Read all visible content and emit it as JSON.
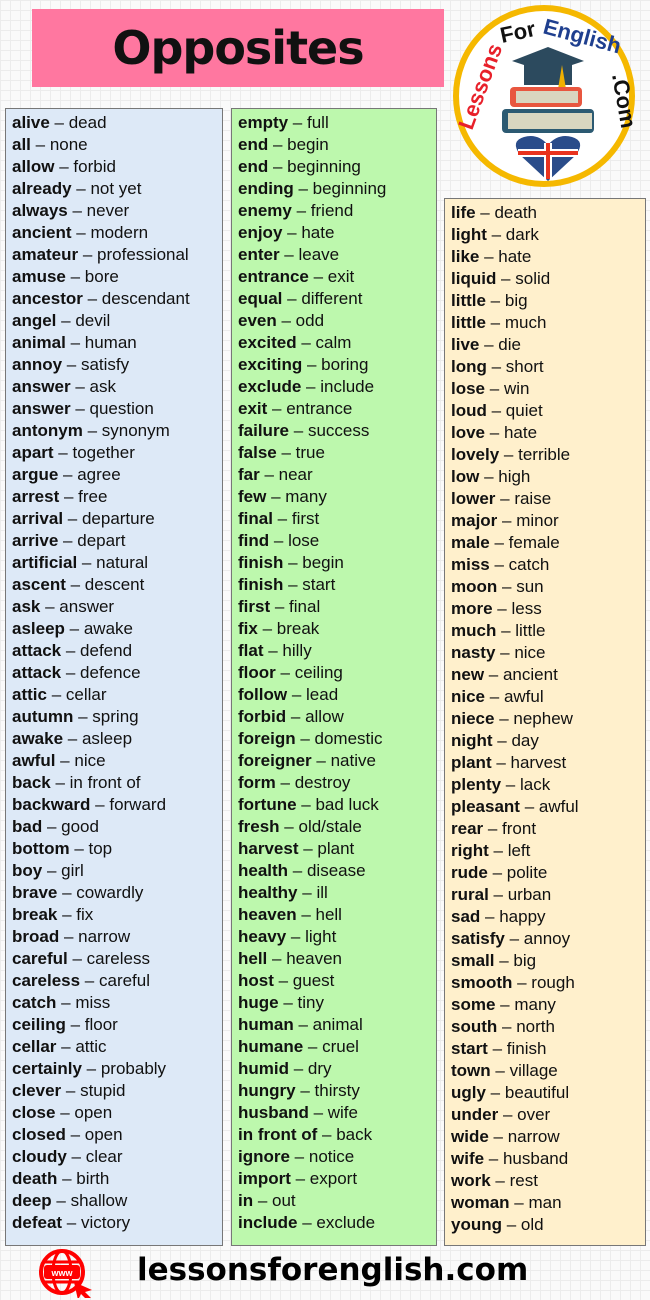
{
  "title": "Opposites",
  "logo_text": "LessonsForEnglish.Com",
  "footer": {
    "url": "lessonsforenglish.com",
    "icon": "www-globe-cursor-icon"
  },
  "colors": {
    "title_bg": "#ff77a0",
    "col1_bg": "#dde9f7",
    "col2_bg": "#bdf8ad",
    "col3_bg": "#fff0cc",
    "logo_ring": "#f5b800"
  },
  "columns": [
    [
      [
        "alive",
        "dead"
      ],
      [
        "all",
        "none"
      ],
      [
        "allow",
        "forbid"
      ],
      [
        "already",
        "not yet"
      ],
      [
        "always",
        "never"
      ],
      [
        "ancient",
        "modern"
      ],
      [
        "amateur",
        "professional"
      ],
      [
        "amuse",
        "bore"
      ],
      [
        "ancestor",
        "descendant"
      ],
      [
        "angel",
        "devil"
      ],
      [
        "animal",
        "human"
      ],
      [
        "annoy",
        "satisfy"
      ],
      [
        "answer",
        "ask"
      ],
      [
        "answer",
        "question"
      ],
      [
        "antonym",
        "synonym"
      ],
      [
        "apart",
        "together"
      ],
      [
        "argue",
        "agree"
      ],
      [
        "arrest",
        "free"
      ],
      [
        "arrival",
        "departure"
      ],
      [
        "arrive",
        "depart"
      ],
      [
        "artificial",
        "natural"
      ],
      [
        "ascent",
        "descent"
      ],
      [
        "ask",
        "answer"
      ],
      [
        "asleep",
        "awake"
      ],
      [
        "attack",
        "defend"
      ],
      [
        "attack",
        "defence"
      ],
      [
        "attic",
        "cellar"
      ],
      [
        "autumn",
        "spring"
      ],
      [
        "awake",
        "asleep"
      ],
      [
        "awful",
        "nice"
      ],
      [
        "back",
        "in front of"
      ],
      [
        "backward",
        "forward"
      ],
      [
        "bad",
        "good"
      ],
      [
        "bottom",
        "top"
      ],
      [
        "boy",
        "girl"
      ],
      [
        "brave",
        "cowardly"
      ],
      [
        "break",
        "fix"
      ],
      [
        "broad",
        "narrow"
      ],
      [
        "careful",
        "careless"
      ],
      [
        "careless",
        "careful"
      ],
      [
        "catch",
        "miss"
      ],
      [
        "ceiling",
        "floor"
      ],
      [
        "cellar",
        "attic"
      ],
      [
        "certainly",
        "probably"
      ],
      [
        "clever",
        "stupid"
      ],
      [
        "close",
        "open"
      ],
      [
        "closed",
        "open"
      ],
      [
        "cloudy",
        "clear"
      ],
      [
        "death",
        "birth"
      ],
      [
        "deep",
        "shallow"
      ],
      [
        "defeat",
        "victory"
      ]
    ],
    [
      [
        "empty",
        "full"
      ],
      [
        "end",
        "begin"
      ],
      [
        "end",
        "beginning"
      ],
      [
        "ending",
        "beginning"
      ],
      [
        "enemy",
        "friend"
      ],
      [
        "enjoy",
        "hate"
      ],
      [
        "enter",
        "leave"
      ],
      [
        "entrance",
        "exit"
      ],
      [
        "equal",
        "different"
      ],
      [
        "even",
        "odd"
      ],
      [
        "excited",
        "calm"
      ],
      [
        "exciting",
        "boring"
      ],
      [
        "exclude",
        "include"
      ],
      [
        "exit",
        "entrance"
      ],
      [
        "failure",
        "success"
      ],
      [
        "false",
        "true"
      ],
      [
        "far",
        "near"
      ],
      [
        "few",
        "many"
      ],
      [
        "final",
        "first"
      ],
      [
        "find",
        "lose"
      ],
      [
        "finish",
        "begin"
      ],
      [
        "finish",
        "start"
      ],
      [
        "first",
        "final"
      ],
      [
        "fix",
        "break"
      ],
      [
        "flat",
        "hilly"
      ],
      [
        "floor",
        "ceiling"
      ],
      [
        "follow",
        "lead"
      ],
      [
        "forbid",
        "allow"
      ],
      [
        "foreign",
        "domestic"
      ],
      [
        "foreigner",
        "native"
      ],
      [
        "form",
        "destroy"
      ],
      [
        "fortune",
        "bad luck"
      ],
      [
        "fresh",
        "old/stale"
      ],
      [
        "harvest",
        "plant"
      ],
      [
        "health",
        "disease"
      ],
      [
        "healthy",
        "ill"
      ],
      [
        "heaven",
        "hell"
      ],
      [
        "heavy",
        "light"
      ],
      [
        "hell",
        "heaven"
      ],
      [
        "host",
        "guest"
      ],
      [
        "huge",
        "tiny"
      ],
      [
        "human",
        "animal"
      ],
      [
        "humane",
        "cruel"
      ],
      [
        "humid",
        "dry"
      ],
      [
        "hungry",
        "thirsty"
      ],
      [
        "husband",
        "wife"
      ],
      [
        "in front of",
        "back"
      ],
      [
        "ignore",
        "notice"
      ],
      [
        "import",
        "export"
      ],
      [
        "in",
        "out"
      ],
      [
        "include",
        "exclude"
      ]
    ],
    [
      [
        "life",
        "death"
      ],
      [
        "light",
        "dark"
      ],
      [
        "like",
        "hate"
      ],
      [
        "liquid",
        "solid"
      ],
      [
        "little",
        "big"
      ],
      [
        "little",
        "much"
      ],
      [
        "live",
        "die"
      ],
      [
        "long",
        "short"
      ],
      [
        "lose",
        "win"
      ],
      [
        "loud",
        "quiet"
      ],
      [
        "love",
        "hate"
      ],
      [
        "lovely",
        "terrible"
      ],
      [
        "low",
        "high"
      ],
      [
        "lower",
        "raise"
      ],
      [
        "major",
        "minor"
      ],
      [
        "male",
        "female"
      ],
      [
        "miss",
        "catch"
      ],
      [
        "moon",
        "sun"
      ],
      [
        "more",
        "less"
      ],
      [
        "much",
        "little"
      ],
      [
        "nasty",
        "nice"
      ],
      [
        "new",
        "ancient"
      ],
      [
        "nice",
        "awful"
      ],
      [
        "niece",
        "nephew"
      ],
      [
        "night",
        "day"
      ],
      [
        "plant",
        "harvest"
      ],
      [
        "plenty",
        "lack"
      ],
      [
        "pleasant",
        "awful"
      ],
      [
        "rear",
        "front"
      ],
      [
        "right",
        "left"
      ],
      [
        "rude",
        "polite"
      ],
      [
        "rural",
        "urban"
      ],
      [
        "sad",
        "happy"
      ],
      [
        "satisfy",
        "annoy"
      ],
      [
        "small",
        "big"
      ],
      [
        "smooth",
        "rough"
      ],
      [
        "some",
        "many"
      ],
      [
        "south",
        "north"
      ],
      [
        "start",
        "finish"
      ],
      [
        "town",
        "village"
      ],
      [
        "ugly",
        "beautiful"
      ],
      [
        "under",
        "over"
      ],
      [
        "wide",
        "narrow"
      ],
      [
        "wife",
        "husband"
      ],
      [
        "work",
        "rest"
      ],
      [
        "woman",
        "man"
      ],
      [
        "young",
        "old"
      ]
    ]
  ]
}
